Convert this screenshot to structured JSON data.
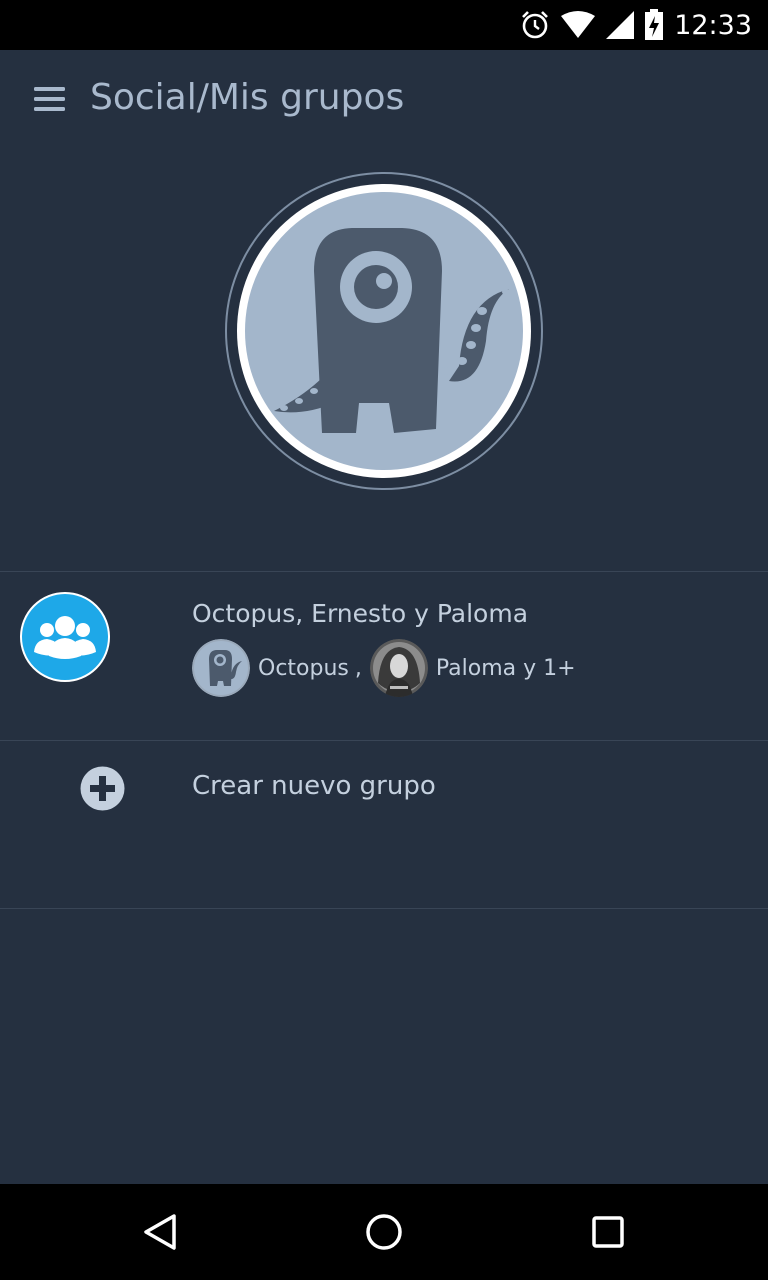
{
  "status_bar": {
    "time": "12:33",
    "icons": [
      "alarm-icon",
      "wifi-icon",
      "signal-icon",
      "battery-charging-icon"
    ]
  },
  "header": {
    "title": "Social/Mis grupos",
    "menu_icon": "hamburger-menu-icon"
  },
  "profile": {
    "avatar_icon": "monster-avatar-icon"
  },
  "groups": [
    {
      "name": "Octopus, Ernesto y Paloma",
      "icon": "group-people-icon",
      "members": [
        {
          "label": "Octopus",
          "separator": ","
        },
        {
          "label": "Paloma y 1+"
        }
      ]
    }
  ],
  "create_group": {
    "label": "Crear nuevo grupo",
    "icon": "plus-circle-icon"
  },
  "nav_bar": {
    "icons": [
      "back-icon",
      "home-icon",
      "recents-icon"
    ]
  },
  "colors": {
    "background": "#253040",
    "accent": "#1EA8E8",
    "text": "#C4D0DE",
    "avatar_bg": "#A3B6CB"
  }
}
